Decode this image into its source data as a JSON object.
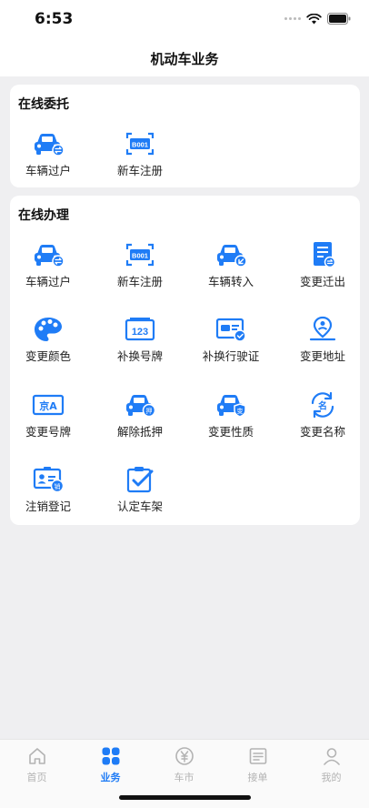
{
  "status": {
    "time": "6:53"
  },
  "nav": {
    "title": "机动车业务"
  },
  "colors": {
    "accent": "#1f7cf6",
    "inactive": "#b3b3b3"
  },
  "section_online_entrust": {
    "title": "在线委托",
    "items": [
      {
        "label": "车辆过户",
        "icon": "car-transfer-icon"
      },
      {
        "label": "新车注册",
        "icon": "plate-scan-icon",
        "plate": "B001"
      }
    ]
  },
  "section_online_handle": {
    "title": "在线办理",
    "items": [
      {
        "label": "车辆过户",
        "icon": "car-transfer-icon"
      },
      {
        "label": "新车注册",
        "icon": "plate-scan-icon",
        "plate": "B001"
      },
      {
        "label": "车辆转入",
        "icon": "car-transfer-in-icon"
      },
      {
        "label": "变更迁出",
        "icon": "document-move-out-icon"
      },
      {
        "label": "变更颜色",
        "icon": "palette-icon"
      },
      {
        "label": "补换号牌",
        "icon": "plate-number-icon",
        "plate": "123"
      },
      {
        "label": "补换行驶证",
        "icon": "license-card-icon"
      },
      {
        "label": "变更地址",
        "icon": "location-pin-icon"
      },
      {
        "label": "变更号牌",
        "icon": "plate-jing-icon",
        "plate": "京A"
      },
      {
        "label": "解除抵押",
        "icon": "car-mortgage-icon",
        "badge": "押"
      },
      {
        "label": "变更性质",
        "icon": "car-nature-icon",
        "badge": "变"
      },
      {
        "label": "变更名称",
        "icon": "name-change-icon",
        "badge": "名"
      },
      {
        "label": "注销登记",
        "icon": "id-cancel-icon",
        "badge": "销"
      },
      {
        "label": "认定车架",
        "icon": "clipboard-check-icon"
      }
    ]
  },
  "tabs": [
    {
      "label": "首页",
      "icon": "home-icon",
      "active": false
    },
    {
      "label": "业务",
      "icon": "grid-icon",
      "active": true
    },
    {
      "label": "车市",
      "icon": "yuan-icon",
      "active": false
    },
    {
      "label": "接单",
      "icon": "order-icon",
      "active": false
    },
    {
      "label": "我的",
      "icon": "user-icon",
      "active": false
    }
  ]
}
